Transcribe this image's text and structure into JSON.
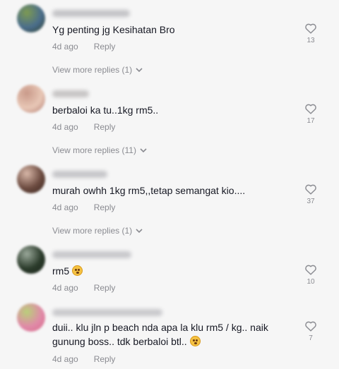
{
  "comments": [
    {
      "text": "Yg penting jg Kesihatan Bro",
      "emoji": false,
      "time": "4d ago",
      "reply_label": "Reply",
      "likes": "13",
      "view_more": "View more replies (1)",
      "avatar_colors": [
        "#4a6d8c",
        "#7d9a52",
        "#2d3f28"
      ]
    },
    {
      "text": "berbaloi ka tu..1kg rm5..",
      "emoji": false,
      "time": "4d ago",
      "reply_label": "Reply",
      "likes": "17",
      "view_more": "View more replies (11)",
      "avatar_colors": [
        "#e8c7b6",
        "#c99a8a",
        "#b07a70"
      ]
    },
    {
      "text": "murah owhh 1kg rm5,,tetap semangat kio....",
      "emoji": false,
      "time": "4d ago",
      "reply_label": "Reply",
      "likes": "37",
      "view_more": "View more replies (1)",
      "avatar_colors": [
        "#6b4a3f",
        "#d8b7a8",
        "#3a2620"
      ]
    },
    {
      "text": "rm5",
      "emoji": true,
      "time": "4d ago",
      "reply_label": "Reply",
      "likes": "10",
      "view_more": "",
      "avatar_colors": [
        "#2a3a2a",
        "#9aa89a",
        "#1d261d"
      ]
    },
    {
      "text": "duii.. klu jln p beach nda apa la klu rm5 / kg.. naik gunung boss.. tdk berbaloi btl..",
      "emoji": true,
      "time": "4d ago",
      "reply_label": "Reply",
      "likes": "7",
      "view_more": "",
      "avatar_colors": [
        "#e08aa8",
        "#b9d07a",
        "#d96a8a"
      ]
    }
  ],
  "icons": {
    "like": "heart-outline-icon",
    "expand": "chevron-down-icon",
    "emoji": "flushed-face-emoji"
  },
  "colors": {
    "background": "#f6f6f6",
    "text": "#161823",
    "muted": "#8a8b91"
  }
}
